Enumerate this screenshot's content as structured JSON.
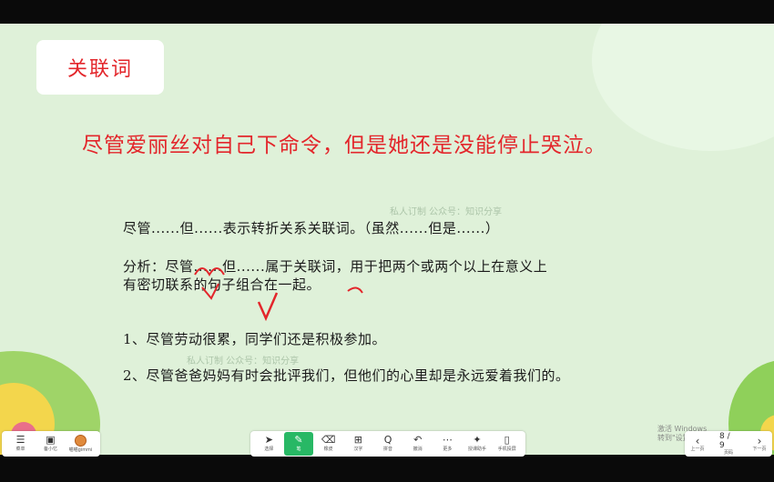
{
  "slide": {
    "title": "关联词",
    "headline": "尽管爱丽丝对自己下命令，但是她还是没能停止哭泣。",
    "lines": [
      "尽管......但......表示转折关系关联词。（虽然......但是......）",
      "分析：尽管......但......属于关联词，用于把两个或两个以上在意义上",
      "有密切联系的句子组合在一起。",
      "1、尽管劳动很累，同学们还是积极参加。",
      "2、尽管爸爸妈妈有时会批评我们，但他们的心里却是永远爱着我们的。"
    ],
    "watermark": "私人订制 公众号：知识分享"
  },
  "windows_notice": {
    "line1": "激活 Windows",
    "line2": "转到\"设置\"以激活 Windows。"
  },
  "left_tools": [
    {
      "icon": "menu-icon",
      "label": "菜单"
    },
    {
      "icon": "board-icon",
      "label": "备小忆"
    },
    {
      "icon": "avatar",
      "label": "喵喵gimmi"
    }
  ],
  "toolbar": [
    {
      "icon": "select-icon",
      "label": "选择",
      "glyph": "➤"
    },
    {
      "icon": "pen-icon",
      "label": "笔",
      "glyph": "✎",
      "active": true
    },
    {
      "icon": "eraser-icon",
      "label": "橡皮",
      "glyph": "⌫"
    },
    {
      "icon": "text-icon",
      "label": "汉字",
      "glyph": "⊞"
    },
    {
      "icon": "search-icon",
      "label": "拼音",
      "glyph": "Q"
    },
    {
      "icon": "undo-icon",
      "label": "撤消",
      "glyph": "↶"
    },
    {
      "icon": "more-icon",
      "label": "更多",
      "glyph": "⋯"
    },
    {
      "icon": "cast-icon",
      "label": "授课助手",
      "glyph": "✦"
    },
    {
      "icon": "phone-icon",
      "label": "手机投屏",
      "glyph": "▯"
    }
  ],
  "pager": {
    "prev_label": "上一页",
    "page_text": "8 / 9",
    "pages_label": "页码",
    "next_label": "下一页"
  },
  "colors": {
    "slide_bg": "#dff1d9",
    "headline_red": "#e3262b",
    "active_tool": "#28b865"
  }
}
